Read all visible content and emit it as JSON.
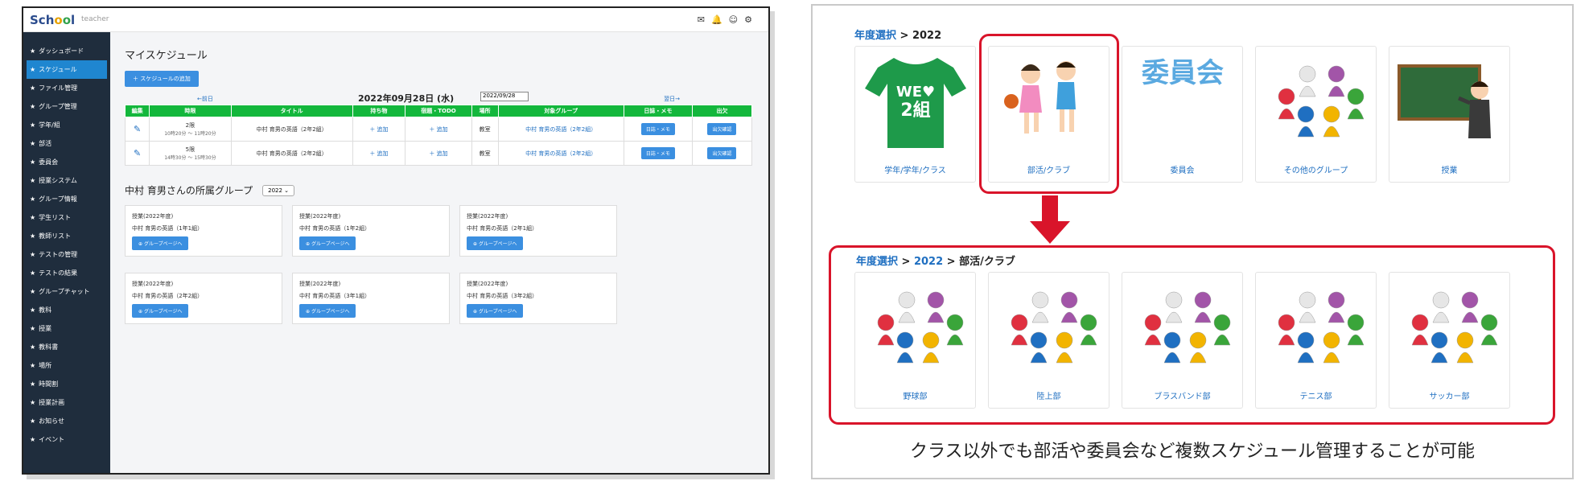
{
  "app": {
    "logo": "School",
    "role": "teacher",
    "sidebar": [
      "ダッシュボード",
      "スケジュール",
      "ファイル管理",
      "グループ管理",
      "学年/組",
      "部活",
      "委員会",
      "授業システム",
      "グループ情報",
      "学生リスト",
      "教師リスト",
      "テストの管理",
      "テストの結果",
      "グループチャット",
      "教科",
      "授業",
      "教科書",
      "場所",
      "時間割",
      "授業計画",
      "お知らせ",
      "イベント"
    ],
    "page_title": "マイスケジュール",
    "add_button": "＋ スケジュールの追加",
    "prev_day": "←前日",
    "next_day": "翌日→",
    "date_title": "2022年09月28日 (水)",
    "date_value": "2022/09/28",
    "table": {
      "headers": [
        "編集",
        "時限",
        "タイトル",
        "持ち物",
        "宿題・TODO",
        "場所",
        "対象グループ",
        "日誌・メモ",
        "出欠"
      ],
      "rows": [
        {
          "period": "2限",
          "time": "10時20分 ～ 11時20分",
          "title": "中村 育男の英語（2年2組）",
          "items": "＋ 追加",
          "todo": "＋ 追加",
          "place": "教室",
          "group": "中村 育男の英語（2年2組）",
          "memo": "日誌・メモ",
          "attend": "出欠確認"
        },
        {
          "period": "5限",
          "time": "14時30分 ～ 15時30分",
          "title": "中村 育男の英語（2年2組）",
          "items": "＋ 追加",
          "todo": "＋ 追加",
          "place": "教室",
          "group": "中村 育男の英語（2年2組）",
          "memo": "日誌・メモ",
          "attend": "出欠確認"
        }
      ]
    },
    "group_title": "中村 育男さんの所属グループ",
    "year_select": "2022",
    "groups": [
      {
        "type": "授業(2022年度)",
        "name": "中村 育男の英語（1年1組）",
        "button": "グループページへ"
      },
      {
        "type": "授業(2022年度)",
        "name": "中村 育男の英語（1年2組）",
        "button": "グループページへ"
      },
      {
        "type": "授業(2022年度)",
        "name": "中村 育男の英語（2年1組）",
        "button": "グループページへ"
      },
      {
        "type": "授業(2022年度)",
        "name": "中村 育男の英語（2年2組）",
        "button": "グループページへ"
      },
      {
        "type": "授業(2022年度)",
        "name": "中村 育男の英語（3年1組）",
        "button": "グループページへ"
      },
      {
        "type": "授業(2022年度)",
        "name": "中村 育男の英語（3年2組）",
        "button": "グループページへ"
      }
    ]
  },
  "figure": {
    "crumb1": {
      "link": "年度選択",
      "rest": " > 2022"
    },
    "crumb2": {
      "link1": "年度選択",
      "sep1": " > ",
      "link2": "2022",
      "rest": " > 部活/クラブ"
    },
    "top_tiles": [
      {
        "label": "学年/学年/クラス",
        "icon": "tshirt-icon",
        "shirt_text": "WE♥ 2組"
      },
      {
        "label": "部活/クラブ",
        "icon": "kids-basketball-icon"
      },
      {
        "label": "委員会",
        "icon": "committee-text-icon",
        "tile_text": "委員会"
      },
      {
        "label": "その他のグループ",
        "icon": "people-pawns-icon"
      },
      {
        "label": "授業",
        "icon": "teacher-blackboard-icon"
      }
    ],
    "bottom_tiles": [
      {
        "label": "野球部",
        "icon": "people-pawns-icon"
      },
      {
        "label": "陸上部",
        "icon": "people-pawns-icon"
      },
      {
        "label": "ブラスバンド部",
        "icon": "people-pawns-icon"
      },
      {
        "label": "テニス部",
        "icon": "people-pawns-icon"
      },
      {
        "label": "サッカー部",
        "icon": "people-pawns-icon"
      }
    ],
    "caption": "クラス以外でも部活や委員会など複数スケジュール管理することが可能",
    "colors": {
      "highlight": "#d9142a",
      "link": "#1f6fc1"
    }
  }
}
